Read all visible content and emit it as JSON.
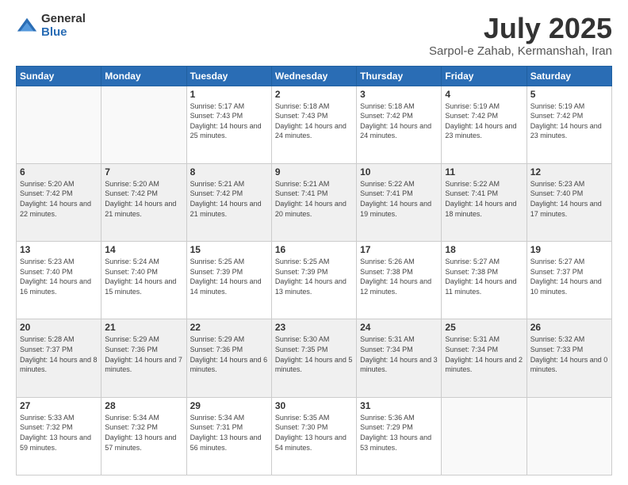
{
  "logo": {
    "general": "General",
    "blue": "Blue"
  },
  "title": {
    "month": "July 2025",
    "location": "Sarpol-e Zahab, Kermanshah, Iran"
  },
  "weekdays": [
    "Sunday",
    "Monday",
    "Tuesday",
    "Wednesday",
    "Thursday",
    "Friday",
    "Saturday"
  ],
  "weeks": [
    [
      {
        "day": "",
        "sunrise": "",
        "sunset": "",
        "daylight": ""
      },
      {
        "day": "",
        "sunrise": "",
        "sunset": "",
        "daylight": ""
      },
      {
        "day": "1",
        "sunrise": "Sunrise: 5:17 AM",
        "sunset": "Sunset: 7:43 PM",
        "daylight": "Daylight: 14 hours and 25 minutes."
      },
      {
        "day": "2",
        "sunrise": "Sunrise: 5:18 AM",
        "sunset": "Sunset: 7:43 PM",
        "daylight": "Daylight: 14 hours and 24 minutes."
      },
      {
        "day": "3",
        "sunrise": "Sunrise: 5:18 AM",
        "sunset": "Sunset: 7:42 PM",
        "daylight": "Daylight: 14 hours and 24 minutes."
      },
      {
        "day": "4",
        "sunrise": "Sunrise: 5:19 AM",
        "sunset": "Sunset: 7:42 PM",
        "daylight": "Daylight: 14 hours and 23 minutes."
      },
      {
        "day": "5",
        "sunrise": "Sunrise: 5:19 AM",
        "sunset": "Sunset: 7:42 PM",
        "daylight": "Daylight: 14 hours and 23 minutes."
      }
    ],
    [
      {
        "day": "6",
        "sunrise": "Sunrise: 5:20 AM",
        "sunset": "Sunset: 7:42 PM",
        "daylight": "Daylight: 14 hours and 22 minutes."
      },
      {
        "day": "7",
        "sunrise": "Sunrise: 5:20 AM",
        "sunset": "Sunset: 7:42 PM",
        "daylight": "Daylight: 14 hours and 21 minutes."
      },
      {
        "day": "8",
        "sunrise": "Sunrise: 5:21 AM",
        "sunset": "Sunset: 7:42 PM",
        "daylight": "Daylight: 14 hours and 21 minutes."
      },
      {
        "day": "9",
        "sunrise": "Sunrise: 5:21 AM",
        "sunset": "Sunset: 7:41 PM",
        "daylight": "Daylight: 14 hours and 20 minutes."
      },
      {
        "day": "10",
        "sunrise": "Sunrise: 5:22 AM",
        "sunset": "Sunset: 7:41 PM",
        "daylight": "Daylight: 14 hours and 19 minutes."
      },
      {
        "day": "11",
        "sunrise": "Sunrise: 5:22 AM",
        "sunset": "Sunset: 7:41 PM",
        "daylight": "Daylight: 14 hours and 18 minutes."
      },
      {
        "day": "12",
        "sunrise": "Sunrise: 5:23 AM",
        "sunset": "Sunset: 7:40 PM",
        "daylight": "Daylight: 14 hours and 17 minutes."
      }
    ],
    [
      {
        "day": "13",
        "sunrise": "Sunrise: 5:23 AM",
        "sunset": "Sunset: 7:40 PM",
        "daylight": "Daylight: 14 hours and 16 minutes."
      },
      {
        "day": "14",
        "sunrise": "Sunrise: 5:24 AM",
        "sunset": "Sunset: 7:40 PM",
        "daylight": "Daylight: 14 hours and 15 minutes."
      },
      {
        "day": "15",
        "sunrise": "Sunrise: 5:25 AM",
        "sunset": "Sunset: 7:39 PM",
        "daylight": "Daylight: 14 hours and 14 minutes."
      },
      {
        "day": "16",
        "sunrise": "Sunrise: 5:25 AM",
        "sunset": "Sunset: 7:39 PM",
        "daylight": "Daylight: 14 hours and 13 minutes."
      },
      {
        "day": "17",
        "sunrise": "Sunrise: 5:26 AM",
        "sunset": "Sunset: 7:38 PM",
        "daylight": "Daylight: 14 hours and 12 minutes."
      },
      {
        "day": "18",
        "sunrise": "Sunrise: 5:27 AM",
        "sunset": "Sunset: 7:38 PM",
        "daylight": "Daylight: 14 hours and 11 minutes."
      },
      {
        "day": "19",
        "sunrise": "Sunrise: 5:27 AM",
        "sunset": "Sunset: 7:37 PM",
        "daylight": "Daylight: 14 hours and 10 minutes."
      }
    ],
    [
      {
        "day": "20",
        "sunrise": "Sunrise: 5:28 AM",
        "sunset": "Sunset: 7:37 PM",
        "daylight": "Daylight: 14 hours and 8 minutes."
      },
      {
        "day": "21",
        "sunrise": "Sunrise: 5:29 AM",
        "sunset": "Sunset: 7:36 PM",
        "daylight": "Daylight: 14 hours and 7 minutes."
      },
      {
        "day": "22",
        "sunrise": "Sunrise: 5:29 AM",
        "sunset": "Sunset: 7:36 PM",
        "daylight": "Daylight: 14 hours and 6 minutes."
      },
      {
        "day": "23",
        "sunrise": "Sunrise: 5:30 AM",
        "sunset": "Sunset: 7:35 PM",
        "daylight": "Daylight: 14 hours and 5 minutes."
      },
      {
        "day": "24",
        "sunrise": "Sunrise: 5:31 AM",
        "sunset": "Sunset: 7:34 PM",
        "daylight": "Daylight: 14 hours and 3 minutes."
      },
      {
        "day": "25",
        "sunrise": "Sunrise: 5:31 AM",
        "sunset": "Sunset: 7:34 PM",
        "daylight": "Daylight: 14 hours and 2 minutes."
      },
      {
        "day": "26",
        "sunrise": "Sunrise: 5:32 AM",
        "sunset": "Sunset: 7:33 PM",
        "daylight": "Daylight: 14 hours and 0 minutes."
      }
    ],
    [
      {
        "day": "27",
        "sunrise": "Sunrise: 5:33 AM",
        "sunset": "Sunset: 7:32 PM",
        "daylight": "Daylight: 13 hours and 59 minutes."
      },
      {
        "day": "28",
        "sunrise": "Sunrise: 5:34 AM",
        "sunset": "Sunset: 7:32 PM",
        "daylight": "Daylight: 13 hours and 57 minutes."
      },
      {
        "day": "29",
        "sunrise": "Sunrise: 5:34 AM",
        "sunset": "Sunset: 7:31 PM",
        "daylight": "Daylight: 13 hours and 56 minutes."
      },
      {
        "day": "30",
        "sunrise": "Sunrise: 5:35 AM",
        "sunset": "Sunset: 7:30 PM",
        "daylight": "Daylight: 13 hours and 54 minutes."
      },
      {
        "day": "31",
        "sunrise": "Sunrise: 5:36 AM",
        "sunset": "Sunset: 7:29 PM",
        "daylight": "Daylight: 13 hours and 53 minutes."
      },
      {
        "day": "",
        "sunrise": "",
        "sunset": "",
        "daylight": ""
      },
      {
        "day": "",
        "sunrise": "",
        "sunset": "",
        "daylight": ""
      }
    ]
  ]
}
